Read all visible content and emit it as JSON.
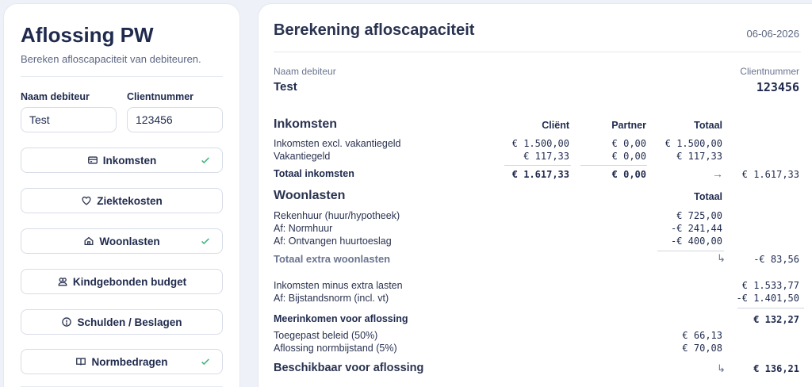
{
  "sidebar": {
    "title": "Aflossing PW",
    "subtitle": "Bereken afloscapaciteit van debiteuren.",
    "name_label": "Naam debiteur",
    "name_value": "Test",
    "client_label": "Clientnummer",
    "client_value": "123456",
    "buttons": [
      {
        "label": "Inkomsten",
        "icon": "card-icon",
        "done": true
      },
      {
        "label": "Ziektekosten",
        "icon": "heart-icon",
        "done": false
      },
      {
        "label": "Woonlasten",
        "icon": "home-icon",
        "done": true
      },
      {
        "label": "Kindgebonden budget",
        "icon": "users-icon",
        "done": false
      },
      {
        "label": "Schulden / Beslagen",
        "icon": "alert-icon",
        "done": false
      },
      {
        "label": "Normbedragen",
        "icon": "book-icon",
        "done": true
      }
    ]
  },
  "report": {
    "title": "Berekening afloscapaciteit",
    "date": "06-06-2026",
    "name_label": "Naam debiteur",
    "name_value": "Test",
    "client_label": "Clientnummer",
    "client_value": "123456",
    "income": {
      "heading": "Inkomsten",
      "col_client": "Cliënt",
      "col_partner": "Partner",
      "col_total": "Totaal",
      "rows": [
        {
          "label": "Inkomsten excl. vakantiegeld",
          "client": "€ 1.500,00",
          "partner": "€ 0,00",
          "total": "€ 1.500,00"
        },
        {
          "label": "Vakantiegeld",
          "client": "€ 117,33",
          "partner": "€ 0,00",
          "total": "€ 117,33"
        }
      ],
      "total_label": "Totaal inkomsten",
      "total_client": "€ 1.617,33",
      "total_partner": "€ 0,00",
      "arrow": "→",
      "total_value": "€ 1.617,33"
    },
    "housing": {
      "heading": "Woonlasten",
      "col_total": "Totaal",
      "rows": [
        {
          "label": "Rekenhuur (huur/hypotheek)",
          "value": "€ 725,00"
        },
        {
          "label": "Af: Normhuur",
          "value": "-€ 241,44"
        },
        {
          "label": "Af: Ontvangen huurtoeslag",
          "value": "-€ 400,00"
        }
      ],
      "total_label": "Totaal extra woonlasten",
      "arrow": "↳",
      "total_value": "-€ 83,56"
    },
    "summary": {
      "income_minus_label": "Inkomsten minus extra lasten",
      "income_minus_value": "€ 1.533,77",
      "norm_label": "Af: Bijstandsnorm (incl. vt)",
      "norm_value": "-€ 1.401,50",
      "surplus_label": "Meerinkomen voor aflossing",
      "surplus_value": "€ 132,27",
      "policy_label": "Toegepast beleid (50%)",
      "policy_value": "€ 66,13",
      "norm_pct_label": "Aflossing normbijstand (5%)",
      "norm_pct_value": "€ 70,08",
      "available_label": "Beschikbaar voor aflossing",
      "arrow": "↳",
      "available_value": "€ 136,21"
    }
  }
}
